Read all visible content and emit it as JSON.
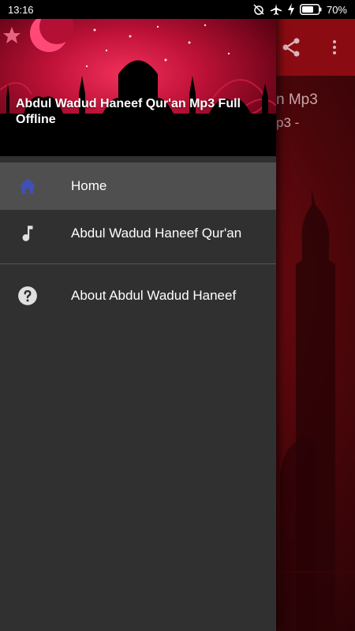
{
  "status_bar": {
    "time": "13:16",
    "battery": "70%"
  },
  "app": {
    "title_fragment": "n Mp3",
    "subtitle_fragment": "p3 -"
  },
  "drawer": {
    "title": "Abdul Wadud Haneef Qur'an Mp3 Full Offline",
    "items": [
      {
        "label": "Home",
        "icon": "home-icon",
        "active": true
      },
      {
        "label": "Abdul Wadud Haneef Qur'an",
        "icon": "music-note-icon",
        "active": false
      }
    ],
    "secondary_items": [
      {
        "label": "About Abdul Wadud Haneef",
        "icon": "help-icon"
      }
    ]
  },
  "colors": {
    "drawer_bg": "#303030",
    "active_item_bg": "#4f4f4f",
    "home_icon": "#3f51b5",
    "header_accent": "#c01238"
  }
}
